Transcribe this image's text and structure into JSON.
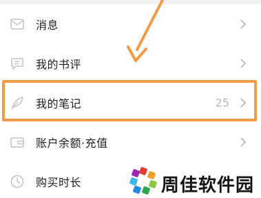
{
  "menu": {
    "items": [
      {
        "label": "消息",
        "icon": "mail-icon",
        "count": ""
      },
      {
        "label": "我的书评",
        "icon": "comment-icon",
        "count": ""
      },
      {
        "label": "我的笔记",
        "icon": "feather-icon",
        "count": "25"
      },
      {
        "label": "账户余额·充值",
        "icon": "wallet-icon",
        "count": ""
      },
      {
        "label": "购买时长",
        "icon": "clock-icon",
        "count": ""
      }
    ]
  },
  "annotation": {
    "color": "#f39a45"
  },
  "watermark": {
    "text": "周佳软件园"
  }
}
